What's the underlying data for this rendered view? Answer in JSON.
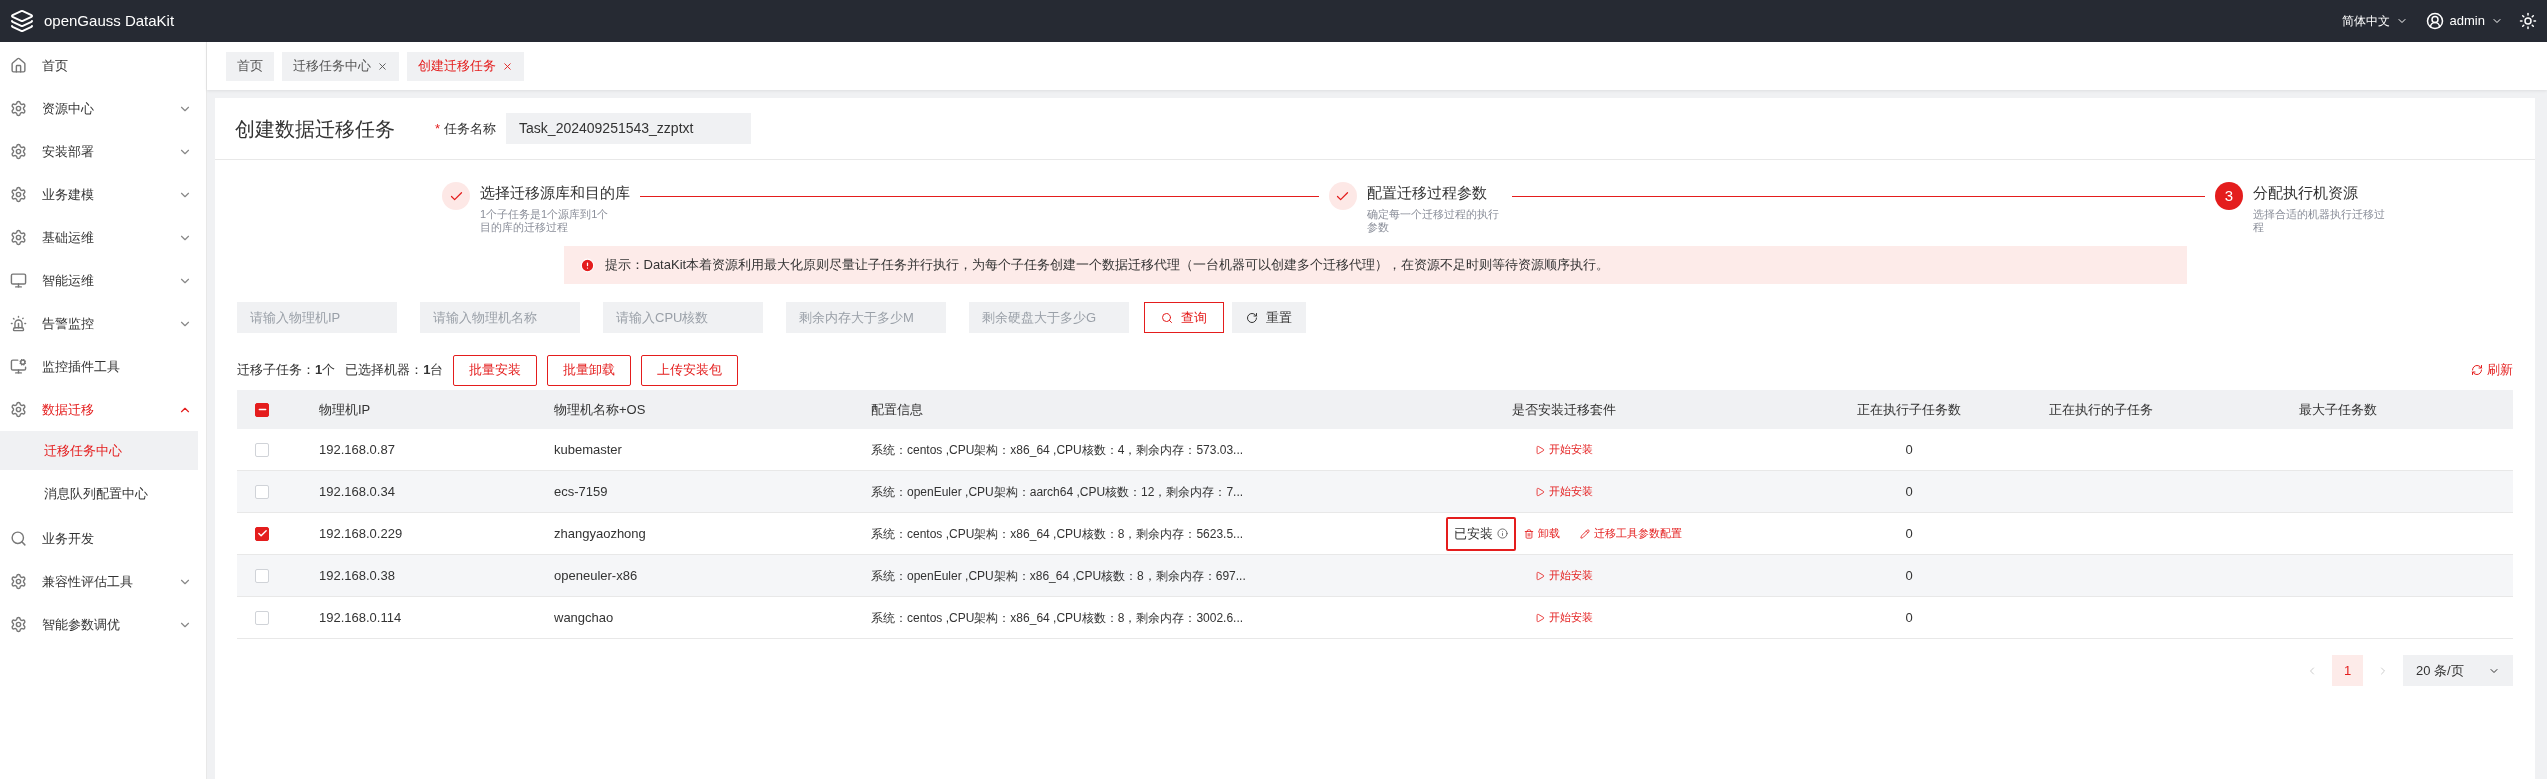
{
  "app": {
    "title": "openGauss DataKit",
    "language": "简体中文",
    "user": "admin"
  },
  "sidebar": {
    "items": [
      {
        "label": "首页",
        "selected": false
      },
      {
        "label": "资源中心",
        "expanded": false,
        "selected": false
      },
      {
        "label": "安装部署",
        "expanded": false,
        "selected": false
      },
      {
        "label": "业务建模",
        "expanded": false,
        "selected": false
      },
      {
        "label": "基础运维",
        "expanded": false,
        "selected": false
      },
      {
        "label": "智能运维",
        "expanded": false,
        "selected": false
      },
      {
        "label": "告警监控",
        "expanded": false,
        "selected": false
      },
      {
        "label": "监控插件工具",
        "selected": false
      },
      {
        "label": "数据迁移",
        "expanded": true,
        "selected": true,
        "children": [
          {
            "label": "迁移任务中心",
            "selected": true
          },
          {
            "label": "消息队列配置中心",
            "selected": false
          }
        ]
      },
      {
        "label": "业务开发",
        "selected": false
      },
      {
        "label": "兼容性评估工具",
        "expanded": false,
        "selected": false
      },
      {
        "label": "智能参数调优",
        "expanded": false,
        "selected": false
      }
    ]
  },
  "tabs": [
    {
      "label": "首页",
      "selected": false,
      "closable": false
    },
    {
      "label": "迁移任务中心",
      "selected": false,
      "closable": true
    },
    {
      "label": "创建迁移任务",
      "selected": true,
      "closable": true
    }
  ],
  "page": {
    "title": "创建数据迁移任务",
    "required_mark": "*",
    "task_name_label": "任务名称",
    "task_name": "Task_202409251543_zzptxt"
  },
  "steps": [
    {
      "title": "选择迁移源库和目的库",
      "description": "1个子任务是1个源库到1个目的库的迁移过程",
      "done": true
    },
    {
      "title": "配置迁移过程参数",
      "description": "确定每一个迁移过程的执行参数",
      "done": true
    },
    {
      "number": "3",
      "title": "分配执行机资源",
      "description": "选择合适的机器执行迁移过程",
      "done": false
    }
  ],
  "hint": "提示：DataKit本着资源利用最大化原则尽量让子任务并行执行，为每个子任务创建一个数据迁移代理（一台机器可以创建多个迁移代理），在资源不足时则等待资源顺序执行。",
  "filters": [
    {
      "placeholder": "请输入物理机IP"
    },
    {
      "placeholder": "请输入物理机名称"
    },
    {
      "placeholder": "请输入CPU核数"
    },
    {
      "placeholder": "剩余内存大于多少M"
    },
    {
      "placeholder": "剩余硬盘大于多少G"
    }
  ],
  "search_button": "查询",
  "reset_button": "重置",
  "summary": {
    "subtasks_label": "迁移子任务：",
    "subtasks": "1",
    "subtasks_unit": "个",
    "machines_label": "已选择机器：",
    "machines": "1",
    "machines_unit": "台"
  },
  "actions": [
    "批量安装",
    "批量卸载",
    "上传安装包"
  ],
  "refresh": "刷新",
  "table": {
    "select_all_indeterminate": true,
    "columns": [
      "物理机IP",
      "物理机名称+OS",
      "配置信息",
      "是否安装迁移套件",
      "正在执行子任务数",
      "正在执行的子任务",
      "最大子任务数"
    ],
    "rows": [
      {
        "checked": false,
        "ip": "192.168.0.87",
        "name": "kubemaster",
        "config": "系统：centos ,CPU架构：x86_64 ,CPU核数：4，剩余内存：573.03...",
        "install": {
          "kind": "action",
          "label": "开始安装"
        },
        "running_count": "0"
      },
      {
        "checked": false,
        "ip": "192.168.0.34",
        "name": "ecs-7159",
        "config": "系统：openEuler ,CPU架构：aarch64 ,CPU核数：12，剩余内存：7...",
        "install": {
          "kind": "action",
          "label": "开始安装"
        },
        "running_count": "0"
      },
      {
        "checked": true,
        "ip": "192.168.0.229",
        "name": "zhangyaozhong",
        "config": "系统：centos ,CPU架构：x86_64 ,CPU核数：8，剩余内存：5623.5...",
        "install": {
          "kind": "installed",
          "status": "已安装",
          "highlighted": true,
          "uninstall": "卸载",
          "configure": "迁移工具参数配置"
        },
        "running_count": "0"
      },
      {
        "checked": false,
        "ip": "192.168.0.38",
        "name": "openeuler-x86",
        "config": "系统：openEuler ,CPU架构：x86_64 ,CPU核数：8，剩余内存：697...",
        "install": {
          "kind": "action",
          "label": "开始安装"
        },
        "running_count": "0"
      },
      {
        "checked": false,
        "ip": "192.168.0.114",
        "name": "wangchao",
        "config": "系统：centos ,CPU架构：x86_64 ,CPU核数：8，剩余内存：3002.6...",
        "install": {
          "kind": "action",
          "label": "开始安装"
        },
        "running_count": "0"
      }
    ]
  },
  "pagination": {
    "pages": [
      {
        "label": "1",
        "selected": true
      }
    ],
    "page_size": "20 条/页"
  }
}
